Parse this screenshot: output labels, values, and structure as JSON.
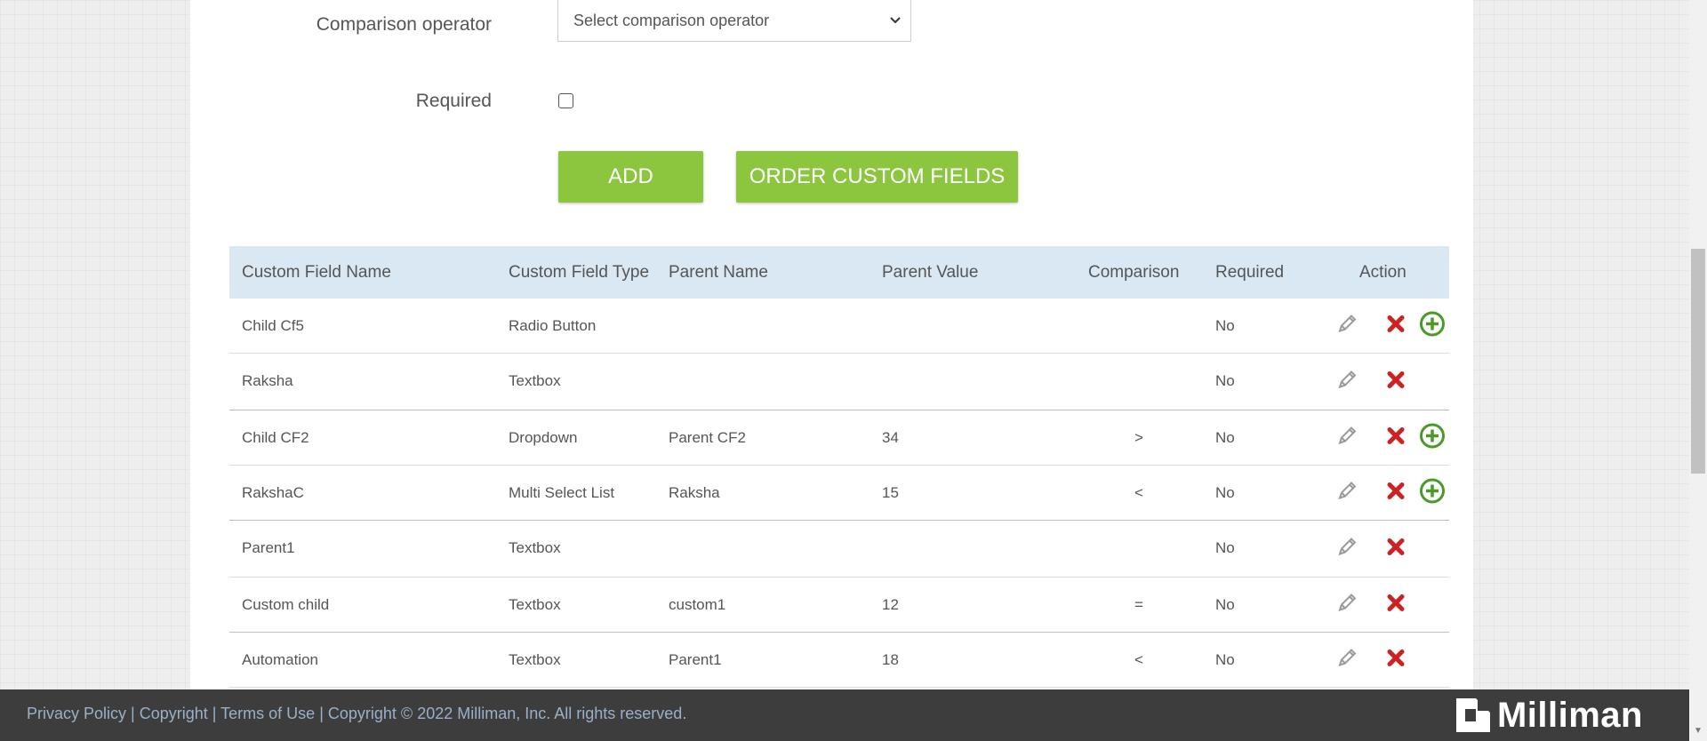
{
  "form": {
    "comparison_label": "Comparison operator",
    "comparison_placeholder": "Select comparison operator",
    "required_label": "Required"
  },
  "buttons": {
    "add": "ADD",
    "order": "ORDER CUSTOM FIELDS"
  },
  "table": {
    "headers": [
      "Custom Field Name",
      "Custom Field Type",
      "Parent Name",
      "Parent Value",
      "Comparison",
      "Required",
      "Action"
    ],
    "rows": [
      {
        "name": "Child Cf5",
        "type": "Radio Button",
        "parent": "",
        "value": "",
        "comparison": "",
        "required": "No",
        "can_add": true
      },
      {
        "name": "Raksha",
        "type": "Textbox",
        "parent": "",
        "value": "",
        "comparison": "",
        "required": "No",
        "can_add": false
      },
      {
        "name": "Child CF2",
        "type": "Dropdown",
        "parent": "Parent CF2",
        "value": "34",
        "comparison": ">",
        "required": "No",
        "can_add": true
      },
      {
        "name": "RakshaC",
        "type": "Multi Select List",
        "parent": "Raksha",
        "value": "15",
        "comparison": "<",
        "required": "No",
        "can_add": true
      },
      {
        "name": "Parent1",
        "type": "Textbox",
        "parent": "",
        "value": "",
        "comparison": "",
        "required": "No",
        "can_add": false
      },
      {
        "name": "Custom child",
        "type": "Textbox",
        "parent": "custom1",
        "value": "12",
        "comparison": "=",
        "required": "No",
        "can_add": false
      },
      {
        "name": "Automation",
        "type": "Textbox",
        "parent": "Parent1",
        "value": "18",
        "comparison": "<",
        "required": "No",
        "can_add": false
      }
    ]
  },
  "footer": {
    "privacy": "Privacy Policy",
    "copyright": "Copyright",
    "terms": "Terms of Use",
    "rights": "Copyright © 2022 Milliman, Inc. All rights reserved.",
    "brand": "Milliman"
  },
  "icons": {
    "chevron": "chevron-down-icon",
    "edit": "pencil-icon",
    "delete": "x-icon",
    "add": "plus-circle-icon"
  },
  "colors": {
    "accent_green": "#8cc63f",
    "header_blue": "#d9e8f3",
    "delete_red": "#cc2222",
    "add_green": "#4a9a2a",
    "footer_bg": "#3d3d3d"
  }
}
